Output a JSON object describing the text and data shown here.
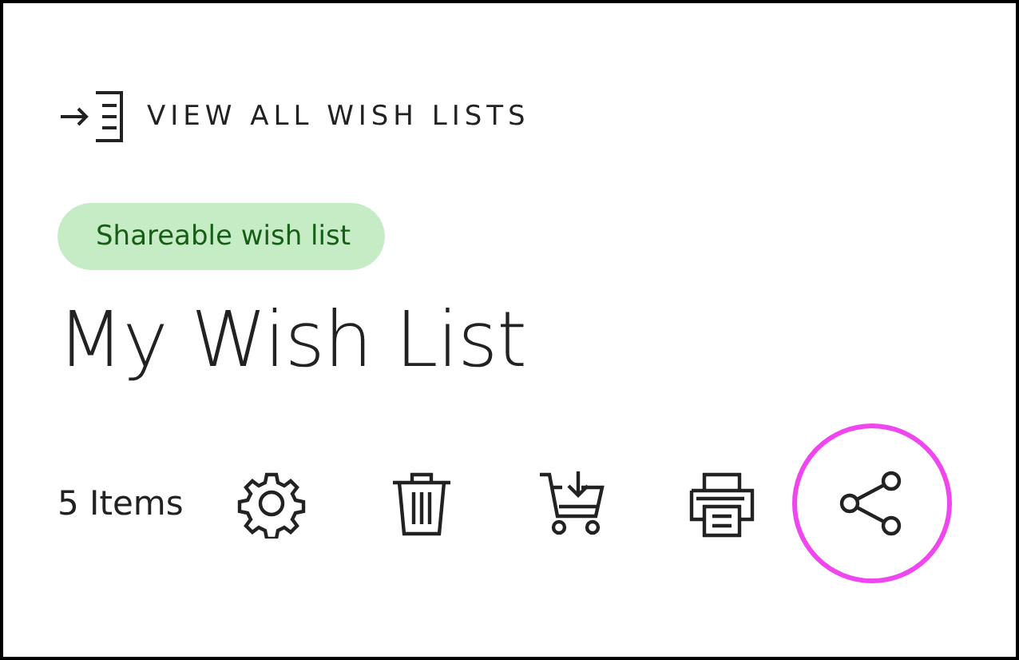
{
  "back_link": {
    "label": "VIEW ALL WISH LISTS"
  },
  "badge": {
    "label": "Shareable wish list"
  },
  "title": "My Wish List",
  "item_count": "5 Items",
  "actions": [
    {
      "kind": "settings",
      "highlighted": false
    },
    {
      "kind": "delete",
      "highlighted": false
    },
    {
      "kind": "cart",
      "highlighted": false
    },
    {
      "kind": "print",
      "highlighted": false
    },
    {
      "kind": "share",
      "highlighted": true
    }
  ]
}
